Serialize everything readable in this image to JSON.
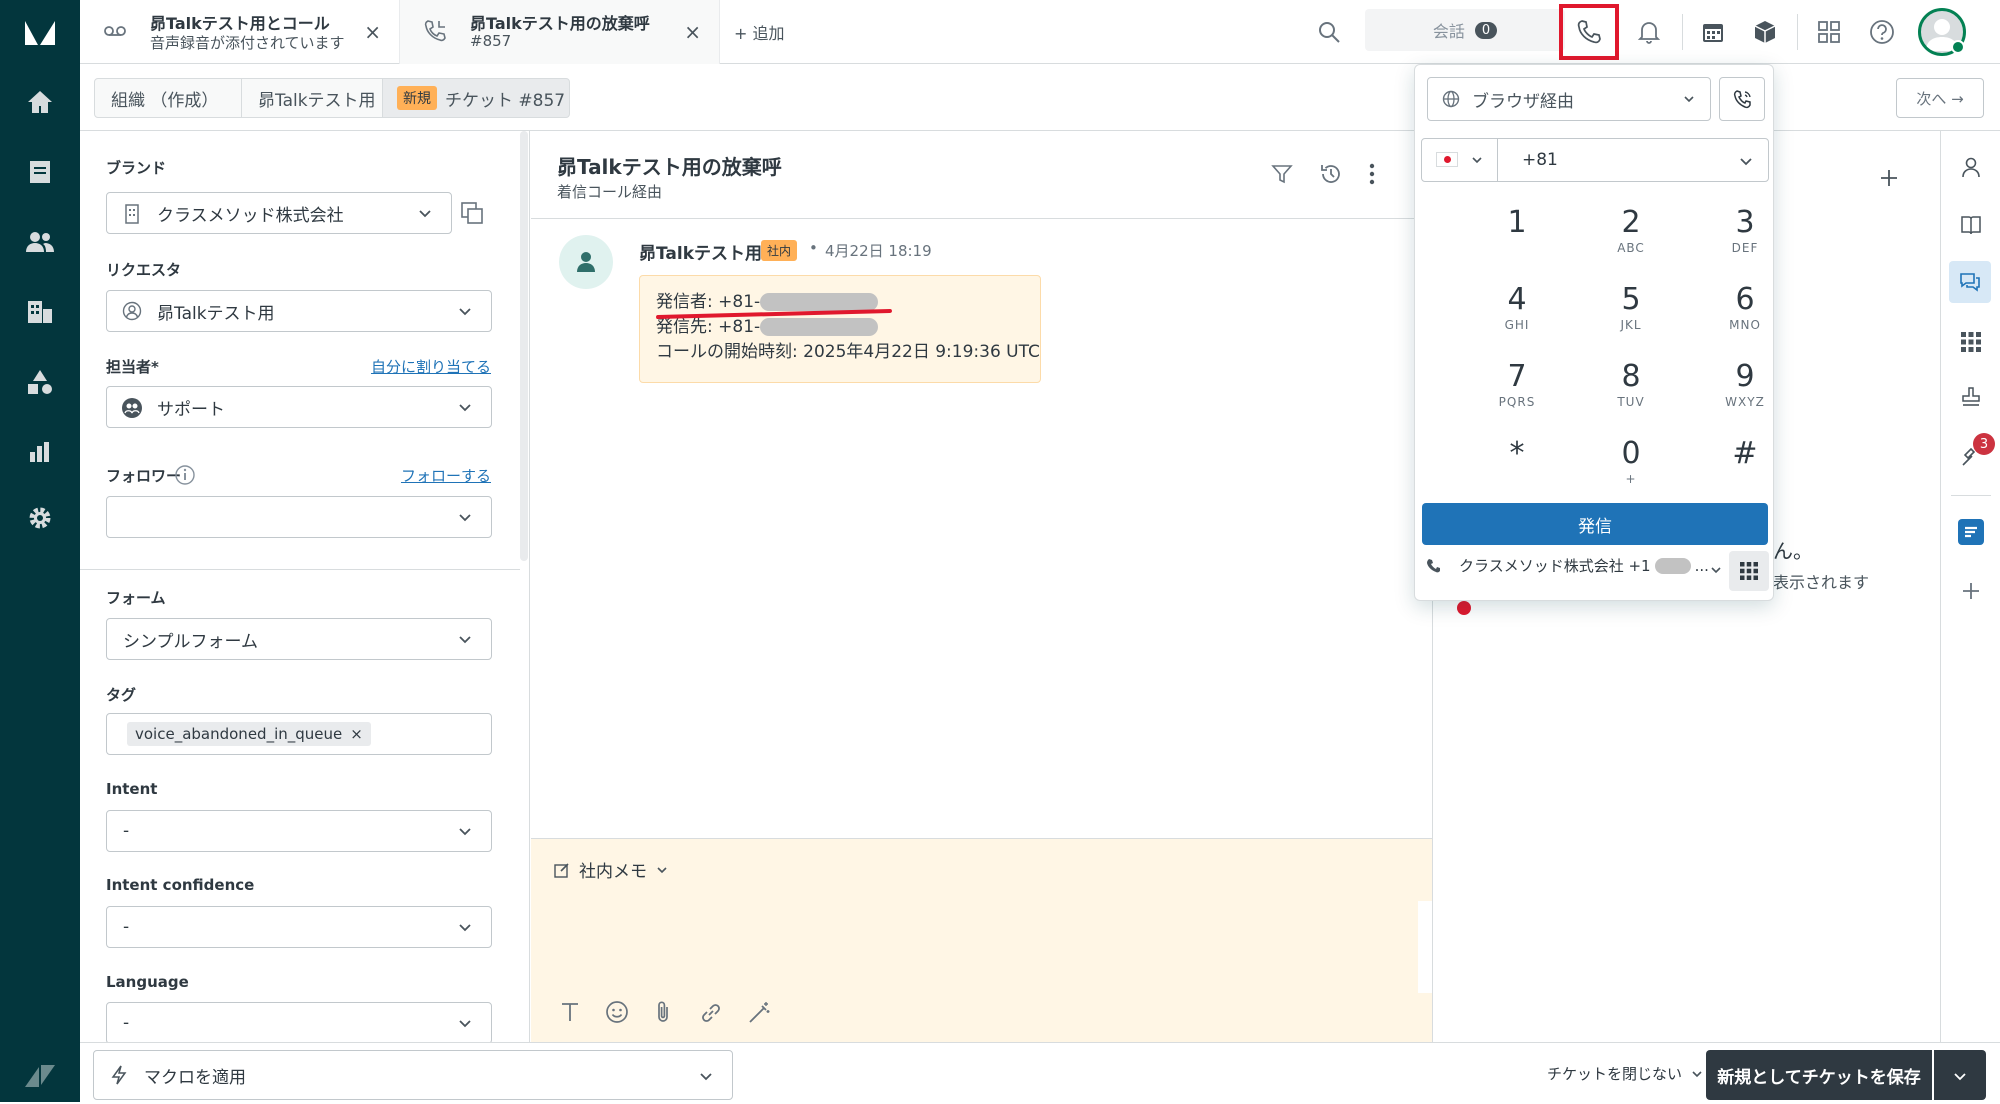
{
  "tabs": [
    {
      "title": "昴Talkテスト用とコール",
      "subtitle": "音声録音が添付されています",
      "close": "×"
    },
    {
      "title": "昴Talkテスト用の放棄呼",
      "subtitle": "#857",
      "close": "×"
    }
  ],
  "add_tab_label": "+ 追加",
  "conversations": {
    "label": "会話",
    "count": "0"
  },
  "breadcrumb": {
    "org": "組織 （作成）",
    "requester": "昴Talkテスト用",
    "badge": "新規",
    "ticket": "チケット #857"
  },
  "next_label": "次へ →",
  "fields": {
    "brand_label": "ブランド",
    "brand_value": "クラスメソッド株式会社",
    "requester_label": "リクエスタ",
    "requester_value": "昴Talkテスト用",
    "assignee_label": "担当者*",
    "assign_self": "自分に割り当てる",
    "assignee_value": "サポート",
    "follower_label": "フォロワー",
    "follow_link": "フォローする",
    "form_label": "フォーム",
    "form_value": "シンプルフォーム",
    "tags_label": "タグ",
    "tag_value": "voice_abandoned_in_queue",
    "tag_close": "×",
    "intent_label": "Intent",
    "intent_value": "-",
    "intent_conf_label": "Intent confidence",
    "intent_conf_value": "-",
    "language_label": "Language",
    "language_value": "-"
  },
  "ticket": {
    "title": "昴Talkテスト用の放棄呼",
    "subtitle": "着信コール経由"
  },
  "message": {
    "author": "昴Talkテスト用",
    "badge": "社内",
    "dot": "•",
    "time": "4月22日 18:19",
    "line1": "発信者: +81-",
    "line2": "発信先: +81-",
    "line3": "コールの開始時刻: 2025年4月22日 9:19:36 UTC"
  },
  "composer": {
    "mode": "社内メモ"
  },
  "dialer": {
    "via": "ブラウザ経由",
    "country_code": "+81",
    "keys": [
      {
        "d": "1",
        "l": ""
      },
      {
        "d": "2",
        "l": "ABC"
      },
      {
        "d": "3",
        "l": "DEF"
      },
      {
        "d": "4",
        "l": "GHI"
      },
      {
        "d": "5",
        "l": "JKL"
      },
      {
        "d": "6",
        "l": "MNO"
      },
      {
        "d": "7",
        "l": "PQRS"
      },
      {
        "d": "8",
        "l": "TUV"
      },
      {
        "d": "9",
        "l": "WXYZ"
      },
      {
        "d": "*",
        "l": ""
      },
      {
        "d": "0",
        "l": "+"
      },
      {
        "d": "#",
        "l": ""
      }
    ],
    "call_button": "発信",
    "line_name": "クラスメソッド株式会社 +1",
    "line_ellipsis": "..."
  },
  "right_panel": {
    "text1": "ん。",
    "text2": "表示されます"
  },
  "rail_badge": "3",
  "bottom": {
    "macro": "マクロを適用",
    "close_option": "チケットを閉じない",
    "save": "新規としてチケットを保存"
  },
  "colors": {
    "nav": "#03363d",
    "highlight": "#e0182d",
    "primary": "#1f73b7",
    "internal_bg": "#fff6e5",
    "badge": "#ffb057"
  }
}
